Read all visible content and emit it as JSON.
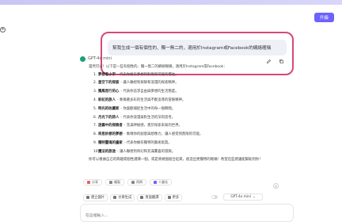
{
  "header": {
    "upgrade_label": "升級"
  },
  "prompt": {
    "text": "幫我生成一個有個性的、獨一無二的，適用於Instagram或Facebook的網絡暱稱"
  },
  "bot": {
    "name": "GPT-4o mini",
    "intro": "當然可以！以下是一些有個性的、獨一無二的網絡暱稱，適用於Instagram或Facebook：",
    "items": [
      {
        "num": "1.",
        "title": "夢想者小宇",
        "desc": "- 代表你擁有夢想和對無限可能的嚮往。"
      },
      {
        "num": "2.",
        "title": "星空下的探索",
        "desc": "- 讓人聯想到探險和浪漫的探索精神。"
      },
      {
        "num": "3.",
        "title": "獨風而行的心",
        "desc": "- 代表你追求自由與夢想的生活態度。"
      },
      {
        "num": "4.",
        "title": "彩虹的旅人",
        "desc": "- 象徵著多彩的生活與不斷追尋的冒險精神。"
      },
      {
        "num": "5.",
        "title": "時光的收藏家",
        "desc": "- 你喜歡捕捉生活中的每一個瞬間。"
      },
      {
        "num": "6.",
        "title": "月光下的詩人",
        "desc": "- 代表你浪漫與對生活的深刻思考。"
      },
      {
        "num": "7.",
        "title": "迷霧中的探險者",
        "desc": "- 充滿神秘感，勇於探索未知的世界。"
      },
      {
        "num": "8.",
        "title": "奇思妙想的夢想",
        "desc": "- 象徵你的創意與想像力，讓人感受到無限的可能。"
      },
      {
        "num": "9.",
        "title": "獨特靈魂的畫家",
        "desc": "- 代表你擁有獨特的藝術氣質。"
      },
      {
        "num": "10.",
        "title": "魔法的旅途",
        "desc": "- 讓人聯想到奇幻和充滿驚喜的冒險。"
      }
    ],
    "outro": "你可以根據自己的興趣或個性選擇一個，或是將幾個組合起來，創造出更獨特的暱稱！希望這些建議能幫助到你！"
  },
  "actions": [
    "分享",
    "複製",
    "再問",
    "人聲化"
  ],
  "toolbar": {
    "items": [
      "建立圖片",
      "文章生成",
      "頁面翻譯",
      "更多"
    ],
    "model": "GPT-4o mini"
  },
  "input": {
    "placeholder": "在這裡輸入..."
  },
  "colors": {
    "accent": "#6c63ff",
    "highlight": "#d8477a",
    "bot_avatar": "#1aa07a"
  }
}
